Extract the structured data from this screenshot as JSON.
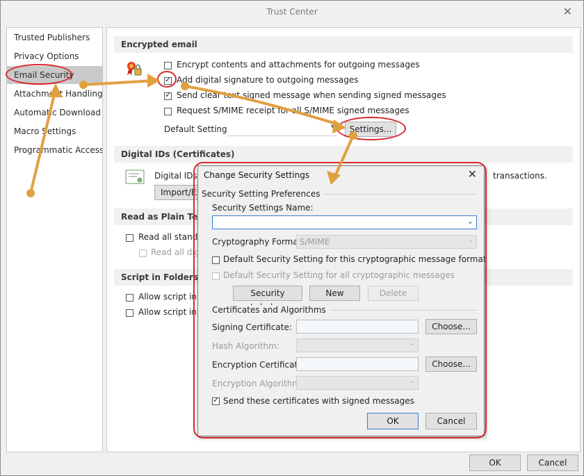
{
  "window": {
    "title": "Trust Center",
    "close": "✕"
  },
  "sidebar": {
    "items": [
      {
        "label": "Trusted Publishers"
      },
      {
        "label": "Privacy Options"
      },
      {
        "label": "Email Security"
      },
      {
        "label": "Attachment Handling"
      },
      {
        "label": "Automatic Download"
      },
      {
        "label": "Macro Settings"
      },
      {
        "label": "Programmatic Access"
      }
    ]
  },
  "encrypted": {
    "header": "Encrypted email",
    "opt1": "Encrypt contents and attachments for outgoing messages",
    "opt2": "Add digital signature to outgoing messages",
    "opt3": "Send clear text signed message when sending signed messages",
    "opt4": "Request S/MIME receipt for all S/MIME signed messages",
    "default_label": "Default Setting:",
    "settings_btn": "Settings..."
  },
  "digital_ids": {
    "header": "Digital IDs (Certificates)",
    "text_left": "Digital IDs o",
    "text_right": "transactions.",
    "import_btn": "Import/Ex"
  },
  "plain_text": {
    "header": "Read as Plain Text",
    "opt1": "Read all standar",
    "opt2": "Read all digi"
  },
  "script": {
    "header": "Script in Folders",
    "opt1": "Allow script in s",
    "opt2": "Allow script in P"
  },
  "footer": {
    "ok": "OK",
    "cancel": "Cancel"
  },
  "dialog": {
    "title": "Change Security Settings",
    "close": "✕",
    "group1": "Security Setting Preferences",
    "name_label": "Security Settings Name:",
    "name_value": "",
    "crypto_label": "Cryptography Format:",
    "crypto_value": "S/MIME",
    "default_format": "Default Security Setting for this cryptographic message format",
    "default_all": "Default Security Setting for all cryptographic messages",
    "security_labels_btn": "Security Labels...",
    "new_btn": "New",
    "delete_btn": "Delete",
    "group2": "Certificates and Algorithms",
    "signing_label": "Signing Certificate:",
    "choose1": "Choose...",
    "hash_label": "Hash Algorithm:",
    "encryption_label": "Encryption Certificate:",
    "choose2": "Choose...",
    "enc_alg_label": "Encryption Algorithm:",
    "send_certs": "Send these certificates with signed messages",
    "ok": "OK",
    "cancel": "Cancel"
  },
  "colors": {
    "annotation_red": "#d9262c",
    "annotation_arrow": "#e0a040"
  }
}
